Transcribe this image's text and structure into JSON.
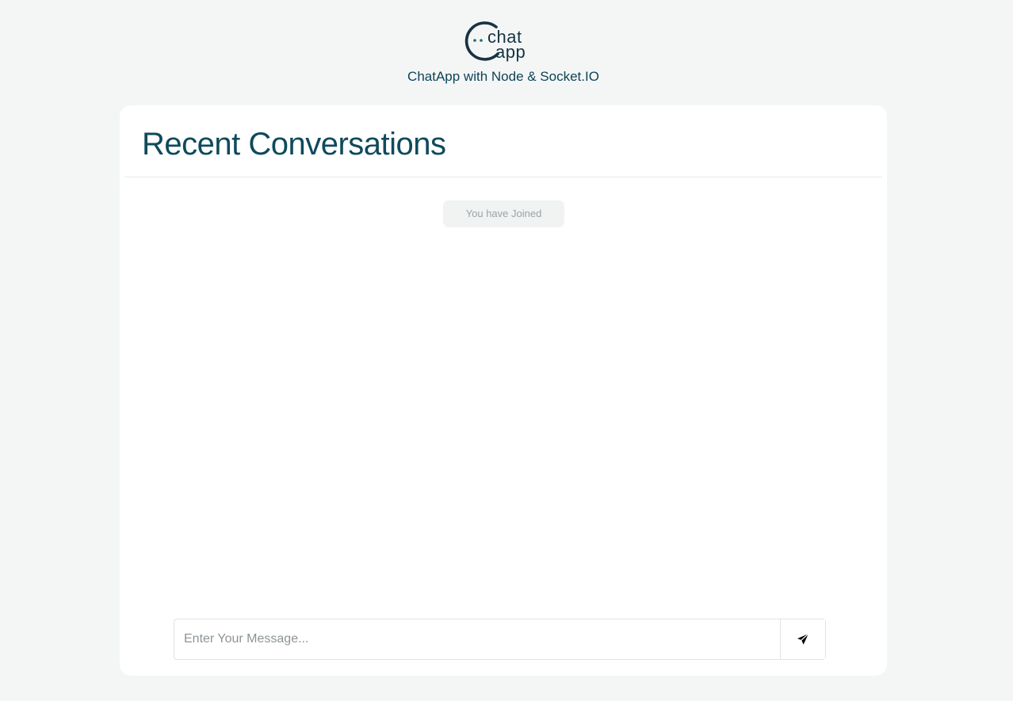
{
  "header": {
    "logo": {
      "word_top": "chat",
      "word_bottom": "app"
    },
    "subtitle": "ChatApp with Node & Socket.IO"
  },
  "conversation": {
    "title": "Recent Conversations",
    "system_message": "You have Joined"
  },
  "composer": {
    "input_value": "",
    "input_placeholder": "Enter Your Message...",
    "send_icon": "paper-plane-icon"
  },
  "colors": {
    "page_background": "#f4f6f6",
    "card_background": "#ffffff",
    "brand_dark": "#0f4a5c",
    "logo_dark": "#163341",
    "system_badge_background": "#f1f3f3",
    "system_badge_text": "#9aa3a6"
  }
}
